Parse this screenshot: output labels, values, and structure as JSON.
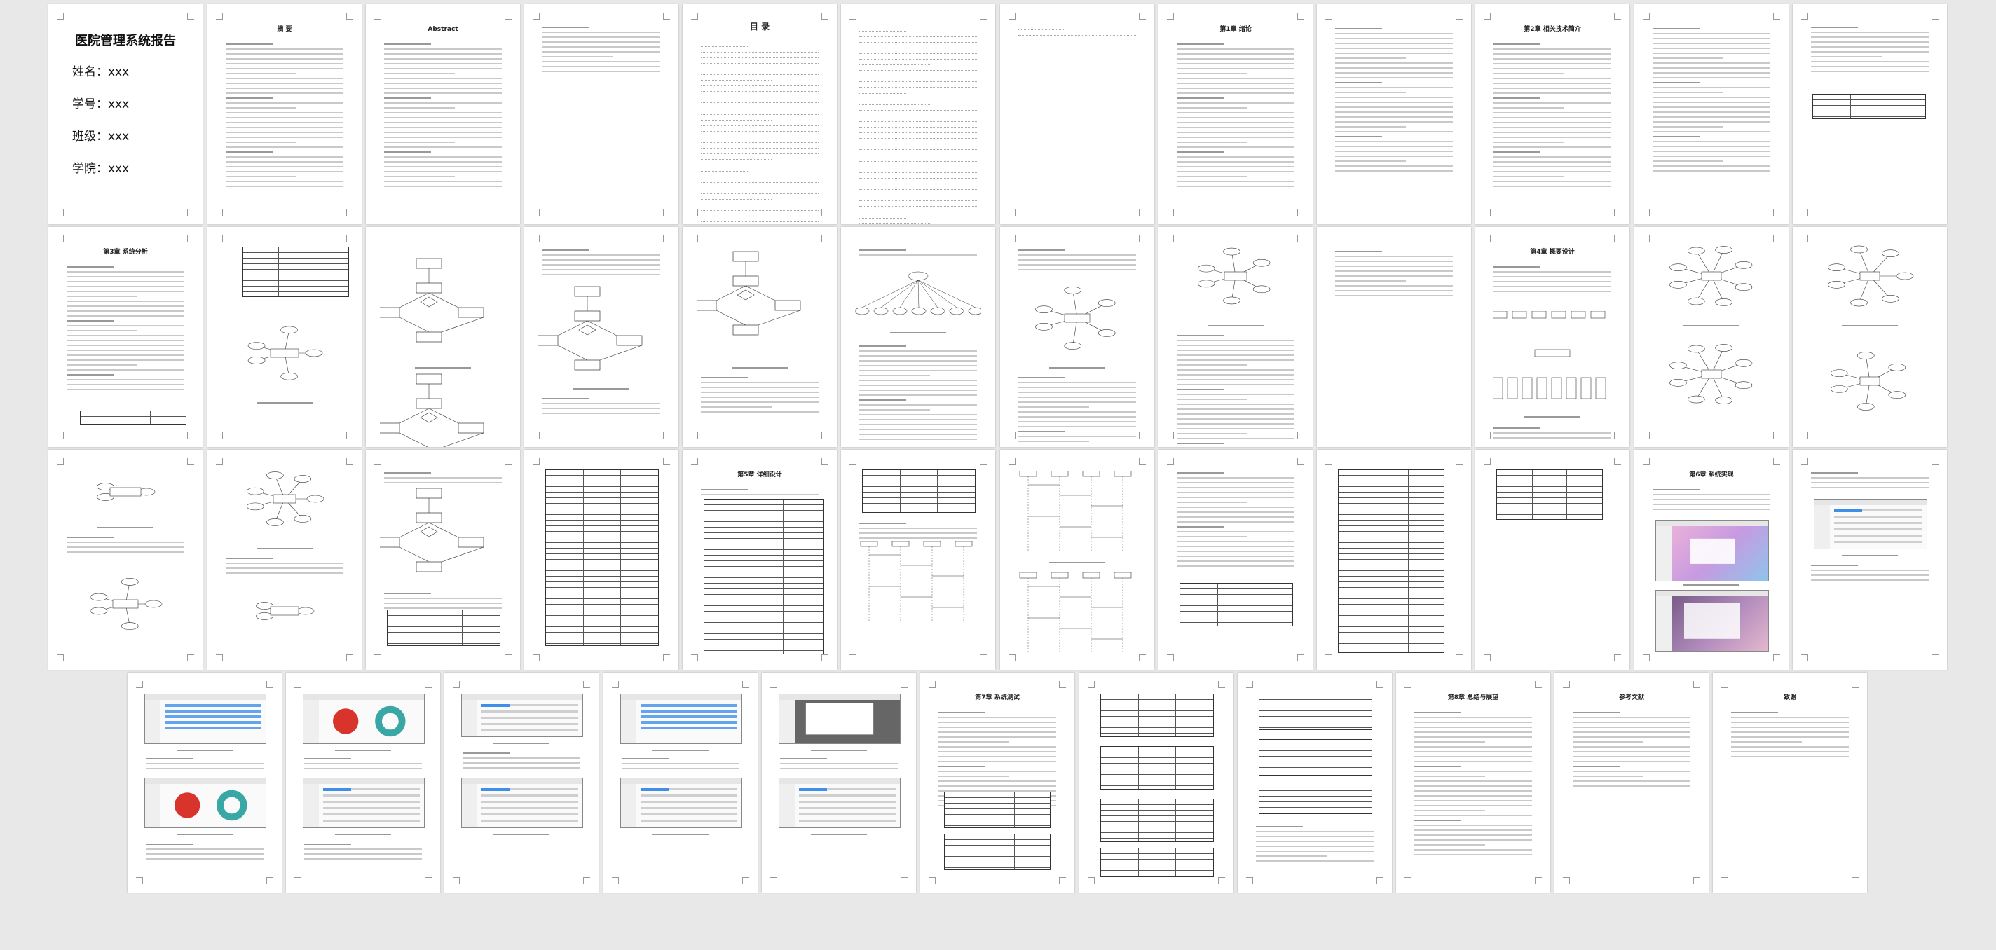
{
  "document": {
    "title": "医院管理系统报告",
    "cover_fields": [
      "姓名：xxx",
      "学号：xxx",
      "班级：xxx",
      "学院：xxx"
    ]
  },
  "page_titles": {
    "abstract_cn": "摘  要",
    "abstract_en": "Abstract",
    "toc": "目    录",
    "ch1": "第1章 绪论",
    "ch2": "第2章 相关技术简介",
    "ch3": "第3章 系统分析",
    "ch4": "第4章 概要设计",
    "ch5": "第5章 详细设计",
    "ch6": "第6章 系统实现",
    "ch7": "第7章 系统测试",
    "ch8": "第8章 总结与展望",
    "refs": "参考文献",
    "thanks": "致谢"
  },
  "colors": {
    "background": "#e8e8e8",
    "page": "#ffffff",
    "text_line": "#c9c9c9",
    "chart_red": "#d9342b",
    "chart_teal": "#3aa7a7",
    "ui_blue": "#3f8fe8"
  }
}
